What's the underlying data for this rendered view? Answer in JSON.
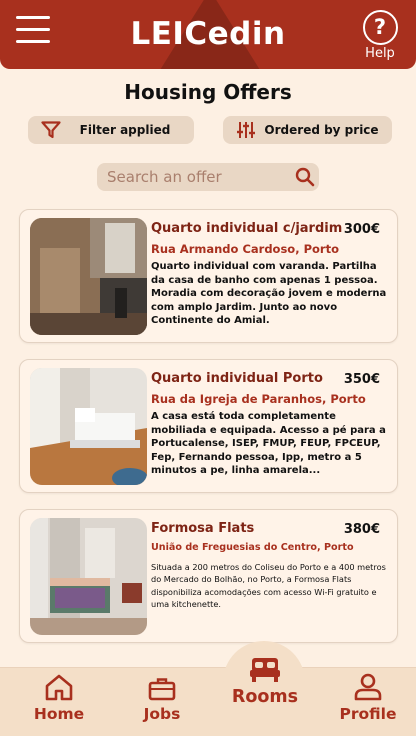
{
  "header": {
    "title": "LEICedin",
    "help_label": "Help",
    "help_glyph": "?"
  },
  "page": {
    "title": "Housing Offers"
  },
  "filters": {
    "filter_label": "Filter applied",
    "order_label": "Ordered by price"
  },
  "search": {
    "placeholder": "Search an offer",
    "value": ""
  },
  "offers": [
    {
      "title": "Quarto individual c/jardim",
      "price": "300€",
      "address": "Rua Armando Cardoso, Porto",
      "description": "Quarto individual com varanda. Partilha da casa de banho com apenas 1 pessoa. Moradia com decoração jovem e moderna com amplo Jardim. Junto ao novo Continente do Amial."
    },
    {
      "title": "Quarto individual Porto",
      "price": "350€",
      "address": "Rua da Igreja de Paranhos, Porto",
      "description": "A casa está toda completamente mobiliada e equipada. Acesso a pé para a Portucalense, ISEP, FMUP, FEUP, FPCEUP, Fep, Fernando pessoa, Ipp, metro a 5 minutos a pe, linha amarela..."
    },
    {
      "title": "Formosa Flats",
      "price": "380€",
      "address": "União de Freguesias do Centro, Porto",
      "description": "Situada a 200 metros do Coliseu do Porto e a 400 metros do Mercado do Bolhão, no Porto, a Formosa Flats disponibiliza acomodações com acesso Wi-Fi gratuito e uma kitchenette."
    }
  ],
  "nav": {
    "items": [
      {
        "label": "Home",
        "icon": "home-icon"
      },
      {
        "label": "Jobs",
        "icon": "briefcase-icon"
      },
      {
        "label": "Rooms",
        "icon": "bed-icon",
        "active": true
      },
      {
        "label": "Profile",
        "icon": "user-icon"
      }
    ]
  },
  "colors": {
    "brand": "#a8301e",
    "background": "#fdf0e3",
    "pill": "#e9d7c5",
    "nav": "#f4dfc8"
  }
}
